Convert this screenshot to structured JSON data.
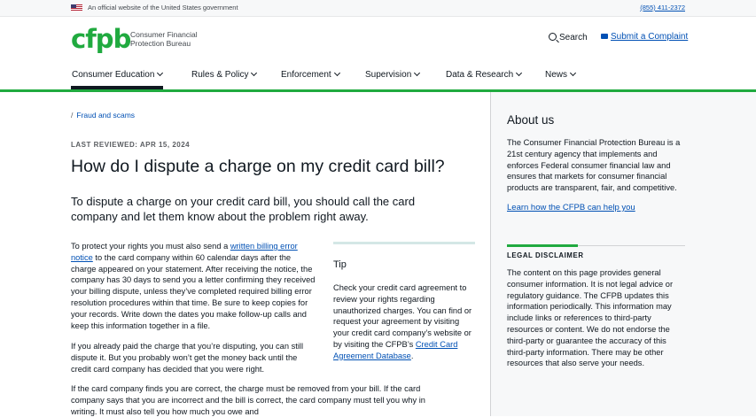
{
  "banner": {
    "official_text": "An official website of the United States government",
    "phone": "(855) 411-2372"
  },
  "header": {
    "logo_text": "cfpb",
    "logo_line1": "Consumer Financial",
    "logo_line2": "Protection Bureau",
    "search_label": "Search",
    "submit_label": "Submit a Complaint"
  },
  "nav": {
    "items": [
      {
        "label": "Consumer Education"
      },
      {
        "label": "Rules & Policy"
      },
      {
        "label": "Enforcement"
      },
      {
        "label": "Supervision"
      },
      {
        "label": "Data & Research"
      },
      {
        "label": "News"
      }
    ]
  },
  "breadcrumb": {
    "separator": "/",
    "link": "Fraud and scams"
  },
  "article": {
    "reviewed": "LAST REVIEWED: APR 15, 2024",
    "title": "How do I dispute a charge on my credit card bill?",
    "lead": "To dispute a charge on your credit card bill, you should call the card company and let them know about the problem right away.",
    "p1_before": "To protect your rights you must also send a ",
    "p1_link": "written billing error notice",
    "p1_after": " to the card company within 60 calendar days after the charge appeared on your statement. After receiving the notice, the company has 30 days to send you a letter confirming they received your billing dispute, unless they’ve completed required billing error resolution procedures within that time. Be sure to keep copies for your records. Write down the dates you make follow-up calls and keep this information together in a file.",
    "p2": "If you already paid the charge that you’re disputing, you can still dispute it. But you probably won’t get the money back until the credit card company has decided that you were right.",
    "p3": "If the card company finds you are correct, the charge must be removed from your bill. If the card company says that you are incorrect and the bill is correct, the card company must tell you why in writing. It must also tell you how much you owe and"
  },
  "tip": {
    "heading": "Tip",
    "text_before": "Check your credit card agreement to review your rights regarding unauthorized charges. You can find or request your agreement by visiting your credit card company’s website or by visiting the CFPB’s ",
    "link": "Credit Card Agreement Database",
    "text_after": "."
  },
  "sidebar": {
    "about_heading": "About us",
    "about_text": "The Consumer Financial Protection Bureau is a 21st century agency that implements and enforces Federal consumer financial law and ensures that markets for consumer financial products are transparent, fair, and competitive.",
    "about_link": "Learn how the CFPB can help you",
    "legal_heading": "LEGAL DISCLAIMER",
    "legal_text": "The content on this page provides general consumer information. It is not legal advice or regulatory guidance. The CFPB updates this information periodically. This information may include links or references to third-party resources or content. We do not endorse the third-party or guarantee the accuracy of this third-party information. There may be other resources that also serve your needs."
  },
  "colors": {
    "brand_green": "#20aa3f",
    "link_blue": "#0050b4",
    "text": "#101820"
  }
}
